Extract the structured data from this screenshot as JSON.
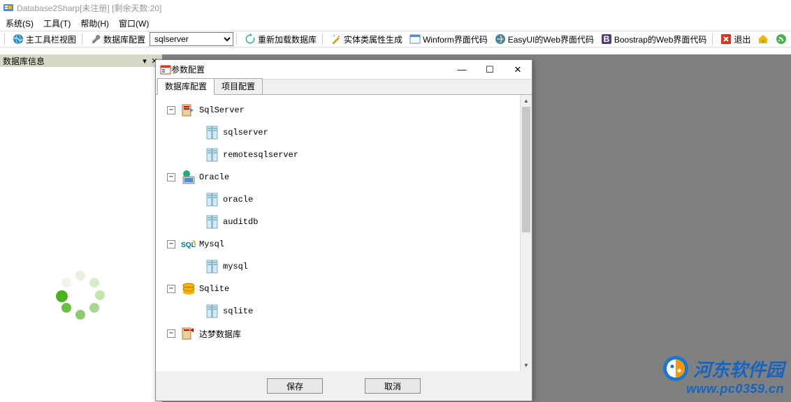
{
  "title": "Database2Sharp[未注册]  [剩余天数:20]",
  "menu": {
    "system": "系统(S)",
    "tools": "工具(T)",
    "help": "帮助(H)",
    "window": "窗口(W)"
  },
  "toolbar": {
    "main_view": "主工具栏视图",
    "db_config": "数据库配置",
    "db_select_value": "sqlserver",
    "reload_db": "重新加载数据库",
    "entity_gen": "实体类属性生成",
    "winform_code": "Winform界面代码",
    "easyui_code": "EasyUI的Web界面代码",
    "bootstrap_code": "Boostrap的Web界面代码",
    "exit": "退出"
  },
  "left_panel": {
    "title": "数据库信息"
  },
  "dialog": {
    "title": "参数配置",
    "tabs": {
      "db": "数据库配置",
      "proj": "项目配置"
    },
    "save": "保存",
    "cancel": "取消",
    "tree": [
      {
        "level": 0,
        "toggle": "-",
        "icon": "sqlserver",
        "label": "SqlServer"
      },
      {
        "level": 1,
        "toggle": "",
        "icon": "db",
        "label": "sqlserver"
      },
      {
        "level": 1,
        "toggle": "",
        "icon": "db",
        "label": "remotesqlserver"
      },
      {
        "level": 0,
        "toggle": "-",
        "icon": "oracle",
        "label": "Oracle"
      },
      {
        "level": 1,
        "toggle": "",
        "icon": "db",
        "label": "oracle"
      },
      {
        "level": 1,
        "toggle": "",
        "icon": "db",
        "label": "auditdb"
      },
      {
        "level": 0,
        "toggle": "-",
        "icon": "mysql",
        "label": "Mysql"
      },
      {
        "level": 1,
        "toggle": "",
        "icon": "db",
        "label": "mysql"
      },
      {
        "level": 0,
        "toggle": "-",
        "icon": "sqlite",
        "label": "Sqlite"
      },
      {
        "level": 1,
        "toggle": "",
        "icon": "db",
        "label": "sqlite"
      },
      {
        "level": 0,
        "toggle": "-",
        "icon": "dm",
        "label": "达梦数据库"
      }
    ]
  },
  "watermark": {
    "name": "河东软件园",
    "url": "www.pc0359.cn"
  }
}
